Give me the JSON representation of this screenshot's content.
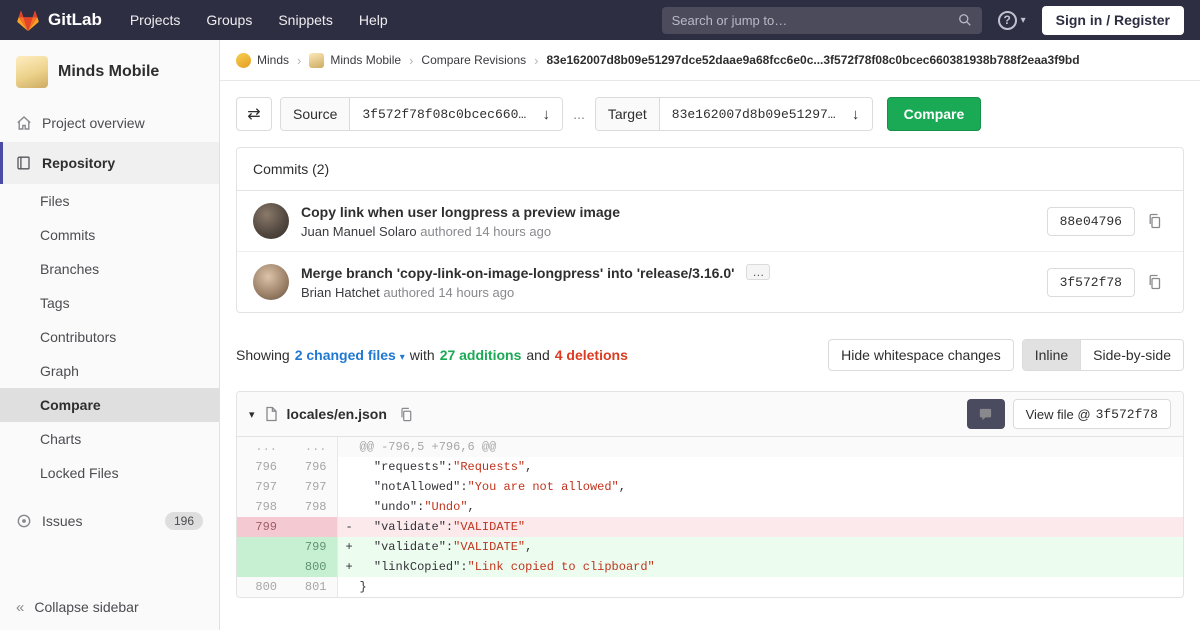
{
  "colors": {
    "navbar_bg": "#2e2e42",
    "accent_green": "#1aaa55",
    "link_blue": "#1f78d1",
    "deletion_red": "#db3b21",
    "sidebar_active_indicator": "#4b4ba3",
    "removed_line_bg": "#fbe9eb",
    "added_line_bg": "#ecfdf0",
    "code_string_color": "#c0341d"
  },
  "navbar": {
    "brand": "GitLab",
    "menu": [
      "Projects",
      "Groups",
      "Snippets",
      "Help"
    ],
    "search_placeholder": "Search or jump to…",
    "sign_in": "Sign in / Register"
  },
  "sidebar": {
    "project_name": "Minds Mobile",
    "overview": "Project overview",
    "repository": "Repository",
    "repo_items": [
      "Files",
      "Commits",
      "Branches",
      "Tags",
      "Contributors",
      "Graph",
      "Compare",
      "Charts",
      "Locked Files"
    ],
    "issues": "Issues",
    "issues_count": "196",
    "collapse": "Collapse sidebar"
  },
  "breadcrumb": {
    "crumbs": [
      "Minds",
      "Minds Mobile",
      "Compare Revisions"
    ],
    "current": "83e162007d8b09e51297dce52daae9a68fcc6e0c...3f572f78f08c0bcec660381938b788f2eaa3f9bd"
  },
  "compare_form": {
    "source_label": "Source",
    "source_value": "3f572f78f08c0bcec660…",
    "separator": "...",
    "target_label": "Target",
    "target_value": "83e162007d8b09e51297…",
    "arrow": "↓",
    "compare_button": "Compare"
  },
  "commits": {
    "title": "Commits (2)",
    "expander": "…",
    "items": [
      {
        "title": "Copy link when user longpress a preview image",
        "author": "Juan Manuel Solaro",
        "meta": "authored 14 hours ago",
        "sha": "88e04796"
      },
      {
        "title": "Merge branch 'copy-link-on-image-longpress' into 'release/3.16.0'",
        "author": "Brian Hatchet",
        "meta": "authored 14 hours ago",
        "sha": "3f572f78"
      }
    ]
  },
  "diff_summary": {
    "showing": "Showing",
    "changed_files": "2 changed files",
    "with": "with",
    "additions": "27 additions",
    "and": "and",
    "deletions": "4 deletions",
    "hide_whitespace": "Hide whitespace changes",
    "inline": "Inline",
    "side_by_side": "Side-by-side"
  },
  "file_diff": {
    "filename": "locales/en.json",
    "view_file_prefix": "View file @",
    "view_file_sha": "3f572f78",
    "lines": [
      {
        "old": "...",
        "new": "...",
        "sign": "",
        "k": "@@ -796,5 +796,6 @@",
        "v": "",
        "t": ""
      },
      {
        "old": "796",
        "new": "796",
        "sign": "",
        "k": "  \"requests\":",
        "v": "\"Requests\"",
        "t": ","
      },
      {
        "old": "797",
        "new": "797",
        "sign": "",
        "k": "  \"notAllowed\":",
        "v": "\"You are not allowed\"",
        "t": ","
      },
      {
        "old": "798",
        "new": "798",
        "sign": "",
        "k": "  \"undo\":",
        "v": "\"Undo\"",
        "t": ","
      },
      {
        "old": "799",
        "new": "",
        "sign": "-",
        "k": "  \"validate\":",
        "v": "\"VALIDATE\"",
        "t": ""
      },
      {
        "old": "",
        "new": "799",
        "sign": "+",
        "k": "  \"validate\":",
        "v": "\"VALIDATE\"",
        "t": ","
      },
      {
        "old": "",
        "new": "800",
        "sign": "+",
        "k": "  \"linkCopied\":",
        "v": "\"Link copied to clipboard\"",
        "t": ""
      },
      {
        "old": "800",
        "new": "801",
        "sign": "",
        "k": "}",
        "v": "",
        "t": ""
      }
    ]
  }
}
